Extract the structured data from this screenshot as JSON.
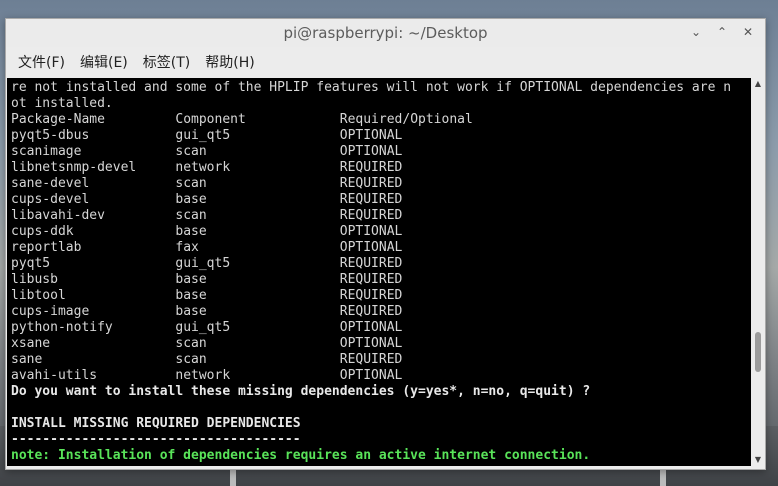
{
  "window": {
    "title": "pi@raspberrypi: ~/Desktop",
    "buttons": {
      "minimize": "⌄",
      "maximize": "⌃",
      "close": "✕"
    }
  },
  "menu": [
    "文件(F)",
    "编辑(E)",
    "标签(T)",
    "帮助(H)"
  ],
  "terminal": {
    "intro1": "re not installed and some of the HPLIP features will not work if OPTIONAL dependencies are n",
    "intro2": "ot installed.",
    "header": {
      "name": "Package-Name",
      "component": "Component",
      "req": "Required/Optional"
    },
    "rows": [
      {
        "name": "pyqt5-dbus",
        "component": "gui_qt5",
        "req": "OPTIONAL"
      },
      {
        "name": "scanimage",
        "component": "scan",
        "req": "OPTIONAL"
      },
      {
        "name": "libnetsnmp-devel",
        "component": "network",
        "req": "REQUIRED"
      },
      {
        "name": "sane-devel",
        "component": "scan",
        "req": "REQUIRED"
      },
      {
        "name": "cups-devel",
        "component": "base",
        "req": "REQUIRED"
      },
      {
        "name": "libavahi-dev",
        "component": "scan",
        "req": "REQUIRED"
      },
      {
        "name": "cups-ddk",
        "component": "base",
        "req": "OPTIONAL"
      },
      {
        "name": "reportlab",
        "component": "fax",
        "req": "OPTIONAL"
      },
      {
        "name": "pyqt5",
        "component": "gui_qt5",
        "req": "REQUIRED"
      },
      {
        "name": "libusb",
        "component": "base",
        "req": "REQUIRED"
      },
      {
        "name": "libtool",
        "component": "base",
        "req": "REQUIRED"
      },
      {
        "name": "cups-image",
        "component": "base",
        "req": "REQUIRED"
      },
      {
        "name": "python-notify",
        "component": "gui_qt5",
        "req": "OPTIONAL"
      },
      {
        "name": "xsane",
        "component": "scan",
        "req": "OPTIONAL"
      },
      {
        "name": "sane",
        "component": "scan",
        "req": "REQUIRED"
      },
      {
        "name": "avahi-utils",
        "component": "network",
        "req": "OPTIONAL"
      }
    ],
    "prompt": "Do you want to install these missing dependencies (y=yes*, n=no, q=quit) ?",
    "blank": "",
    "section_title": "INSTALL MISSING REQUIRED DEPENDENCIES",
    "divider": "-------------------------------------",
    "note": "note: Installation of dependencies requires an active internet connection."
  },
  "colors": {
    "terminal_bg": "#000000",
    "terminal_text": "#d6d6d6",
    "note_green": "#59e359"
  }
}
